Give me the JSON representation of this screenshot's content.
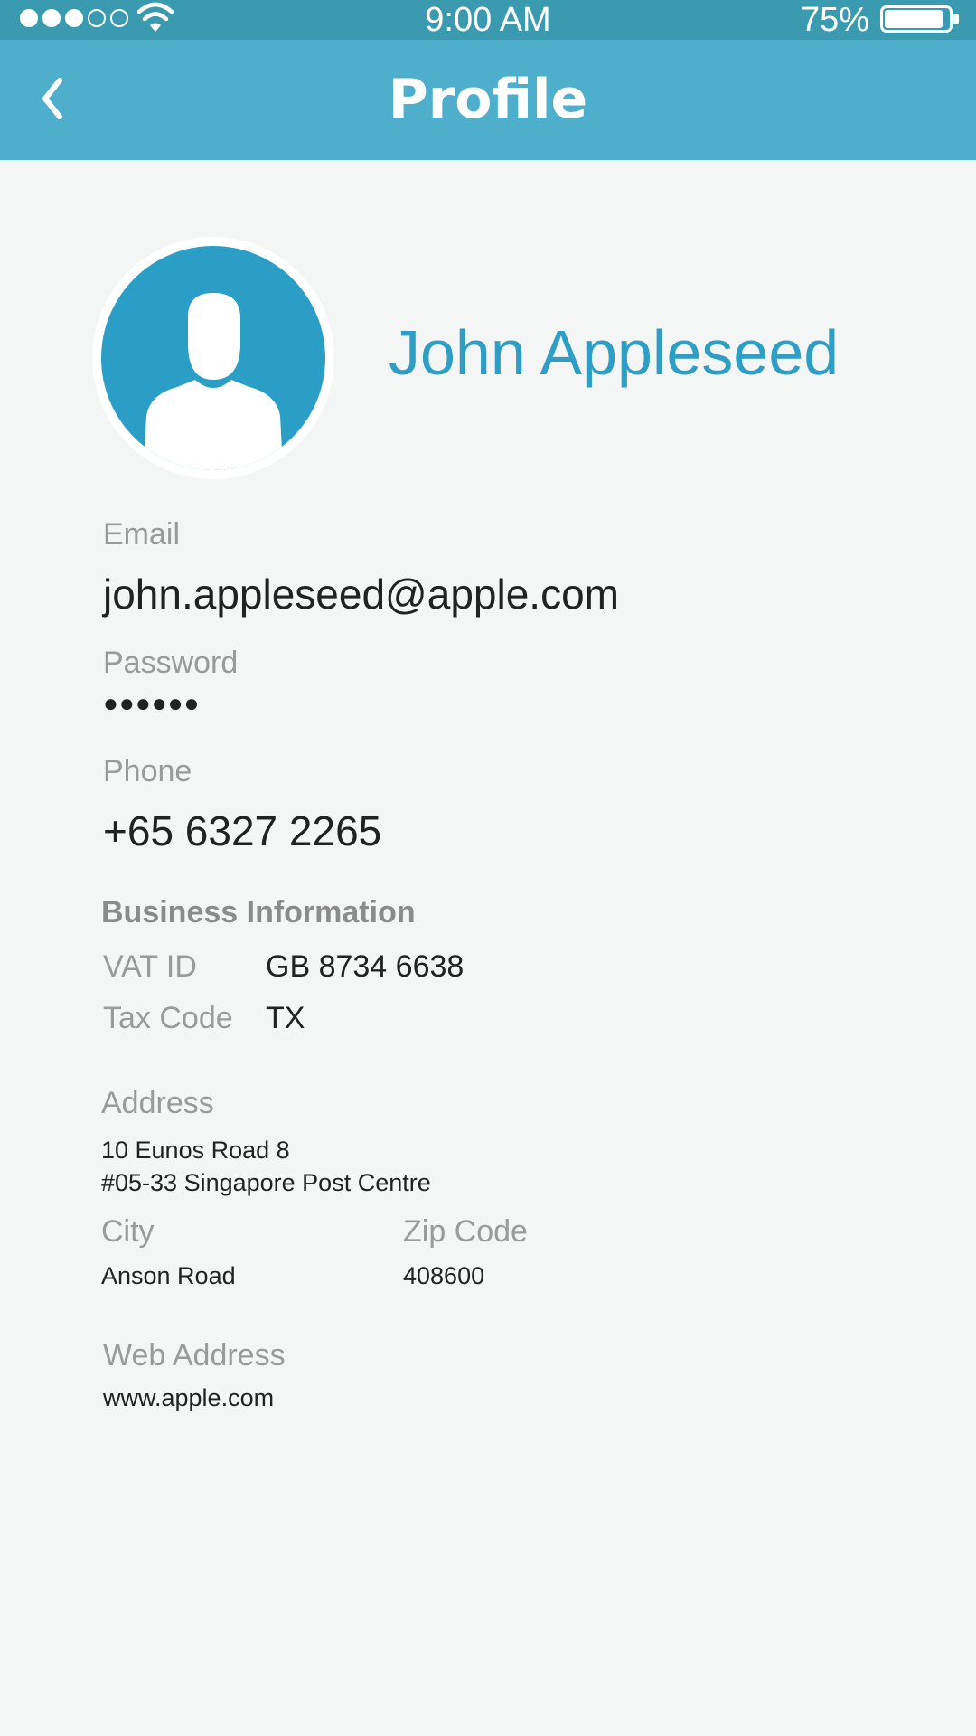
{
  "status_bar": {
    "signal_filled": 3,
    "signal_total": 5,
    "time": "9:00 AM",
    "battery_percent": "75%",
    "battery_level": 0.92
  },
  "nav": {
    "title": "Profile",
    "back_icon": "chevron-left-icon"
  },
  "profile": {
    "name": "John Appleseed",
    "avatar_icon": "user-silhouette-icon"
  },
  "fields": {
    "email": {
      "label": "Email",
      "value": "john.appleseed@apple.com"
    },
    "password": {
      "label": "Password",
      "value": "●●●●●●"
    },
    "phone": {
      "label": "Phone",
      "value": "+65 6327 2265"
    }
  },
  "business": {
    "title": "Business Information",
    "vat": {
      "label": "VAT ID",
      "value": "GB 8734 6638"
    },
    "tax": {
      "label": "Tax Code",
      "value": "TX"
    }
  },
  "address": {
    "label": "Address",
    "line1": "10 Eunos Road 8",
    "line2": "#05-33 Singapore Post Centre",
    "city": {
      "label": "City",
      "value": "Anson Road"
    },
    "zip": {
      "label": "Zip Code",
      "value": "408600"
    }
  },
  "web": {
    "label": "Web Address",
    "value": "www.apple.com"
  },
  "colors": {
    "status_bar": "#3a9bb0",
    "nav_bar": "#4dafcb",
    "accent": "#2f9ec5",
    "avatar_bg": "#2b9ec6",
    "background": "#f4f5f5"
  }
}
